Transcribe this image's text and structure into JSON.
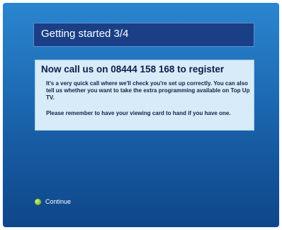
{
  "header": {
    "title": "Getting started 3/4"
  },
  "panel": {
    "headline": "Now call us on 08444 158 168 to register",
    "paragraph1": "It's a very quick call where we'll check you're set up correctly. You can also tell us whether you want to take the extra programming available on Top Up TV.",
    "paragraph2": "Please remember to have your viewing card to hand if you have one."
  },
  "footer": {
    "continue_label": "Continue",
    "continue_icon": "green-button-icon",
    "continue_color": "#8cc63f"
  },
  "colors": {
    "background_top": "#2a86cf",
    "background_bottom": "#0f4689",
    "title_bar": "#1a3f86",
    "panel": "#d7ebf8",
    "headline_text": "#0b1f4a"
  }
}
